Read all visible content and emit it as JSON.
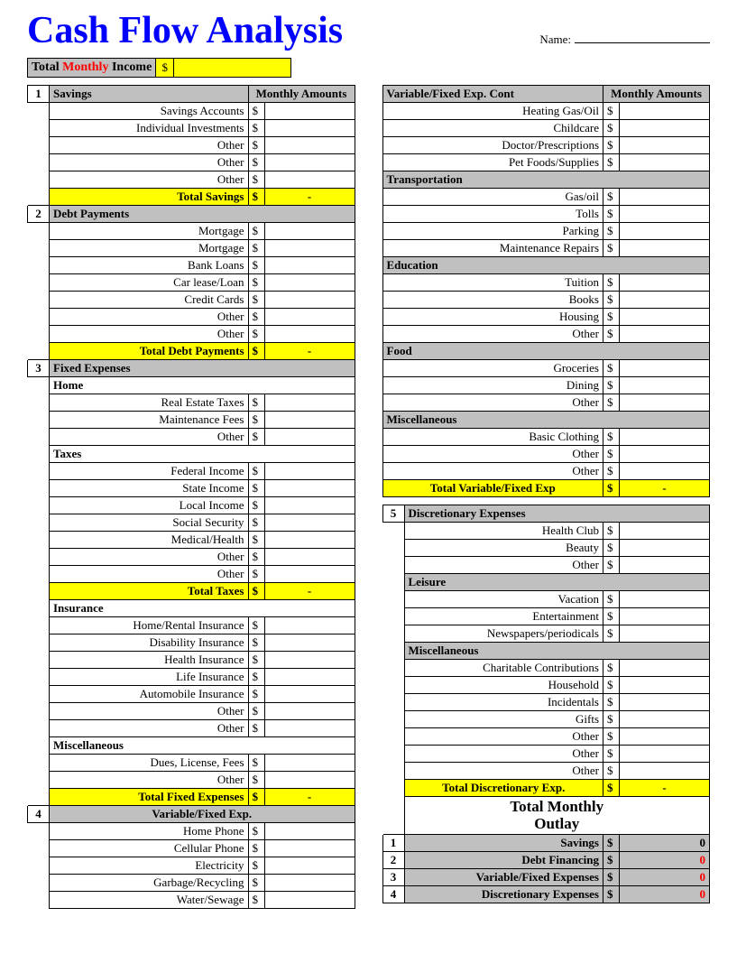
{
  "title": "Cash Flow Analysis",
  "name_label": "Name:",
  "income": {
    "prefix": "Total",
    "mid": "Monthly",
    "suffix": "Income",
    "dollar": "$"
  },
  "hdr_amounts": "Monthly Amounts",
  "left": {
    "s1": {
      "num": "1",
      "title": "Savings",
      "items": [
        "Savings Accounts",
        "Individual Investments",
        "Other",
        "Other",
        "Other"
      ],
      "total": "Total Savings",
      "total_val": "-"
    },
    "s2": {
      "num": "2",
      "title": "Debt Payments",
      "items": [
        "Mortgage",
        "Mortgage",
        "Bank Loans",
        "Car lease/Loan",
        "Credit Cards",
        "Other",
        "Other"
      ],
      "total": "Total Debt Payments",
      "total_val": "-"
    },
    "s3": {
      "num": "3",
      "title": "Fixed Expenses",
      "home": {
        "title": "Home",
        "items": [
          "Real Estate Taxes",
          "Maintenance Fees",
          "Other"
        ]
      },
      "taxes": {
        "title": "Taxes",
        "items": [
          "Federal Income",
          "State Income",
          "Local Income",
          "Social Security",
          "Medical/Health",
          "Other",
          "Other"
        ],
        "total": "Total Taxes",
        "total_val": "-"
      },
      "ins": {
        "title": "Insurance",
        "items": [
          "Home/Rental Insurance",
          "Disability Insurance",
          "Health Insurance",
          "Life Insurance",
          "Automobile Insurance",
          "Other",
          "Other"
        ]
      },
      "misc": {
        "title": "Miscellaneous",
        "items": [
          "Dues, License, Fees",
          "Other"
        ]
      },
      "total": "Total Fixed Expenses",
      "total_val": "-"
    },
    "s4": {
      "num": "4",
      "title": "Variable/Fixed Exp.",
      "items": [
        "Home Phone",
        "Cellular Phone",
        "Electricity",
        "Garbage/Recycling",
        "Water/Sewage"
      ]
    }
  },
  "right": {
    "cont": {
      "title": "Variable/Fixed Exp. Cont",
      "items": [
        "Heating Gas/Oil",
        "Childcare",
        "Doctor/Prescriptions",
        "Pet Foods/Supplies"
      ]
    },
    "trans": {
      "title": "Transportation",
      "items": [
        "Gas/oil",
        "Tolls",
        "Parking",
        "Maintenance Repairs"
      ]
    },
    "edu": {
      "title": "Education",
      "items": [
        "Tuition",
        "Books",
        "Housing",
        "Other"
      ]
    },
    "food": {
      "title": "Food",
      "items": [
        "Groceries",
        "Dining",
        "Other"
      ]
    },
    "misc1": {
      "title": "Miscellaneous",
      "items": [
        "Basic Clothing",
        "Other",
        "Other"
      ],
      "total": "Total Variable/Fixed Exp",
      "total_val": "-"
    },
    "s5": {
      "num": "5",
      "title": "Discretionary Expenses",
      "items": [
        "Health Club",
        "Beauty",
        "Other"
      ]
    },
    "leisure": {
      "title": "Leisure",
      "items": [
        "Vacation",
        "Entertainment",
        "Newspapers/periodicals"
      ]
    },
    "misc2": {
      "title": "Miscellaneous",
      "items": [
        "Charitable Contributions",
        "Household",
        "Incidentals",
        "Gifts",
        "Other",
        "Other",
        "Other"
      ],
      "total": "Total Discretionary Exp.",
      "total_val": "-"
    },
    "outlay": {
      "title": "Total Monthly Outlay",
      "rows": [
        {
          "n": "1",
          "label": "Savings",
          "val": "0",
          "black": true
        },
        {
          "n": "2",
          "label": "Debt Financing",
          "val": "0"
        },
        {
          "n": "3",
          "label": "Variable/Fixed Expenses",
          "val": "0"
        },
        {
          "n": "4",
          "label": "Discretionary Expenses",
          "val": "0"
        }
      ]
    }
  },
  "dollar": "$"
}
